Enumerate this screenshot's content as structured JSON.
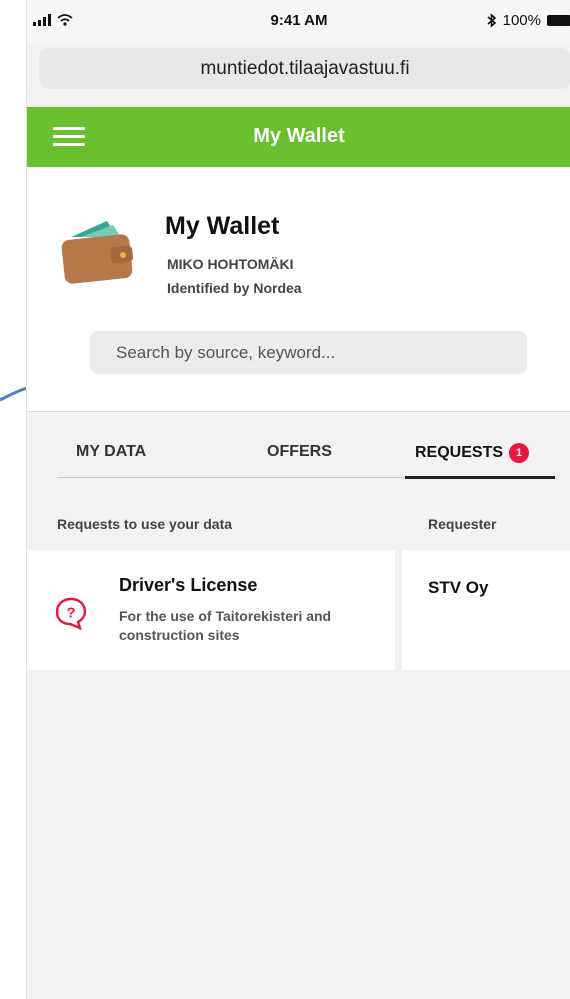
{
  "status_bar": {
    "time": "9:41 AM",
    "battery": "100%"
  },
  "browser": {
    "url": "muntiedot.tilaajavastuu.fi"
  },
  "app_header": {
    "title": "My Wallet"
  },
  "wallet": {
    "title": "My Wallet",
    "user_name": "MIKO HOHTOMÄKI",
    "identified_by": "Identified by Nordea"
  },
  "search": {
    "placeholder": "Search by source, keyword..."
  },
  "tabs": {
    "my_data": "MY DATA",
    "offers": "OFFERS",
    "requests": "REQUESTS",
    "requests_badge": "1",
    "active": "REQUESTS"
  },
  "table": {
    "headers": [
      "Requests to use your data",
      "Requester"
    ],
    "rows": [
      {
        "title": "Driver's License",
        "description": "For the use of Taitorekisteri and construction sites",
        "requester": "STV Oy"
      }
    ]
  },
  "colors": {
    "accent": "#6abf2e",
    "badge": "#e8163f",
    "arrow": "#4a7fc1"
  }
}
